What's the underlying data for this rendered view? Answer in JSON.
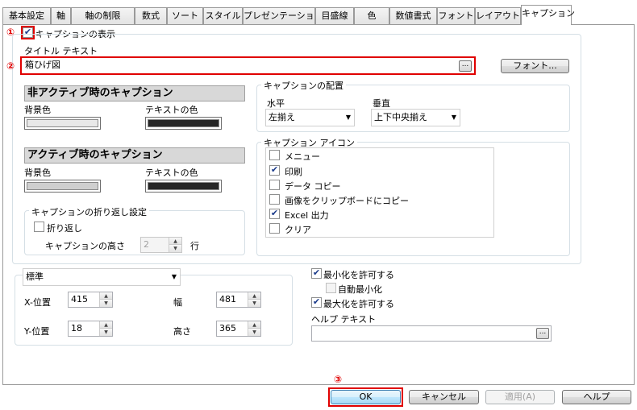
{
  "tabs": [
    "基本設定",
    "軸",
    "軸の制限",
    "数式",
    "ソート",
    "スタイル",
    "プレゼンテーション",
    "目盛線",
    "色",
    "数値書式",
    "フォント",
    "レイアウト",
    "キャプション"
  ],
  "markers": {
    "m1": "①",
    "m2": "②",
    "m3": "③"
  },
  "show_caption": {
    "label": "キャプションの表示",
    "checked": true
  },
  "title_text": {
    "label": "タイトル テキスト",
    "value": "箱ひげ図",
    "ellipsis": "..."
  },
  "font_button": "フォント...",
  "inactive": {
    "header": "非アクティブ時のキャプション",
    "bg_label": "背景色",
    "text_label": "テキストの色"
  },
  "active": {
    "header": "アクティブ時のキャプション",
    "bg_label": "背景色",
    "text_label": "テキストの色"
  },
  "colors": {
    "inactive_bg": "#e8e8e8",
    "inactive_text": "#262626",
    "active_bg": "#cfcfcf",
    "active_text": "#262626",
    "highlight": "#e00000"
  },
  "wrap": {
    "title": "キャプションの折り返し設定",
    "wrap_label": "折り返し",
    "height_label": "キャプションの高さ",
    "height_value": "2",
    "unit": "行"
  },
  "placement": {
    "title": "キャプションの配置",
    "horizontal_label": "水平",
    "horizontal_value": "左揃え",
    "vertical_label": "垂直",
    "vertical_value": "上下中央揃え"
  },
  "icons": {
    "title": "キャプション アイコン",
    "items": [
      {
        "label": "メニュー",
        "checked": false
      },
      {
        "label": "印刷",
        "checked": true
      },
      {
        "label": "データ コピー",
        "checked": false
      },
      {
        "label": "画像をクリップボードにコピー",
        "checked": false
      },
      {
        "label": "Excel 出力",
        "checked": true
      },
      {
        "label": "クリア",
        "checked": false
      }
    ]
  },
  "position": {
    "mode": "標準",
    "x_label": "X-位置",
    "x_value": "415",
    "y_label": "Y-位置",
    "y_value": "18",
    "w_label": "幅",
    "w_value": "481",
    "h_label": "高さ",
    "h_value": "365"
  },
  "window": {
    "min_label": "最小化を許可する",
    "min_checked": true,
    "automin_label": "自動最小化",
    "automin_checked": false,
    "max_label": "最大化を許可する",
    "max_checked": true,
    "help_label": "ヘルプ テキスト",
    "help_value": ""
  },
  "buttons": {
    "ok": "OK",
    "cancel": "キャンセル",
    "apply": "適用(A)",
    "help": "ヘルプ"
  }
}
